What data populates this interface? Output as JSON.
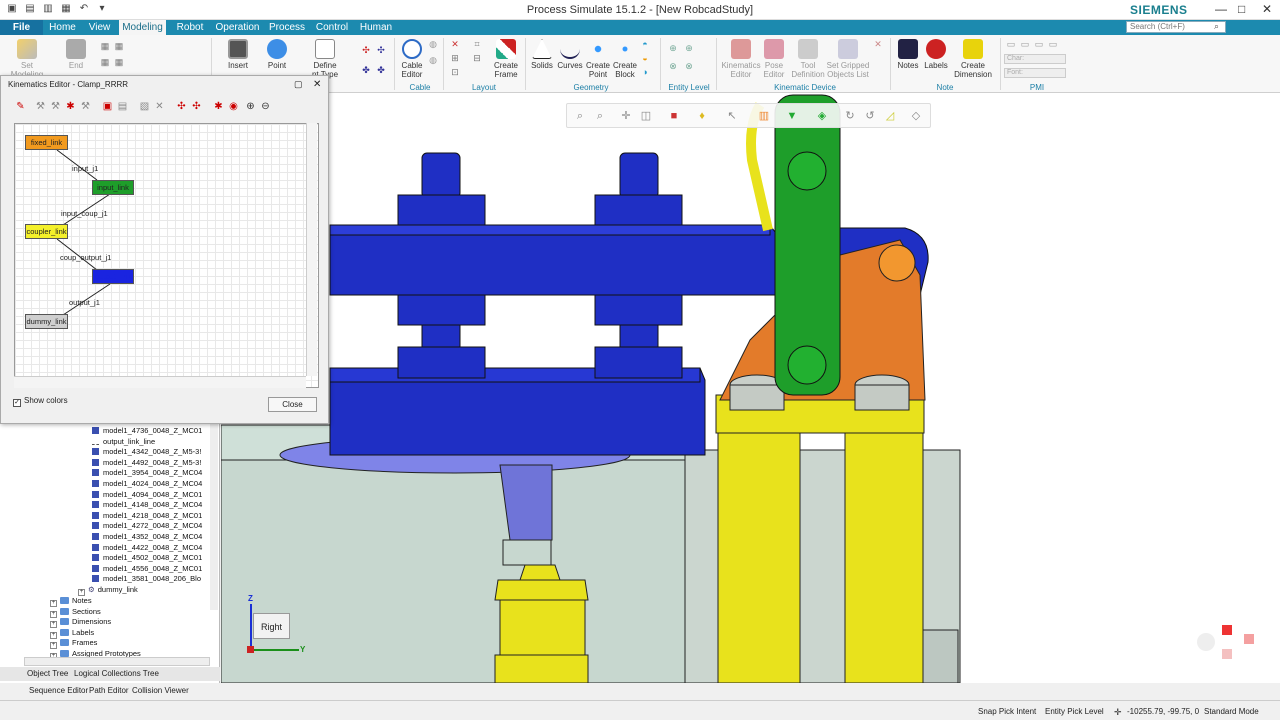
{
  "app": {
    "title": "Process Simulate 15.1.2 - [New RobcadStudy]",
    "brand": "SIEMENS"
  },
  "menu": {
    "tabs": [
      "File",
      "Home",
      "View",
      "Modeling",
      "Robot",
      "Operation",
      "Process",
      "Control",
      "Human"
    ],
    "active": "Modeling"
  },
  "search": {
    "placeholder": "Search (Ctrl+F)"
  },
  "ribbon": {
    "buttons": {
      "set_modeling": "Set Modeling",
      "end": "End",
      "insert": "Insert",
      "point": "Point",
      "define": "Define",
      "joint_type": "nt Type",
      "cable_editor_1": "Cable",
      "cable_editor_2": "Editor",
      "create_frame_1": "Create",
      "create_frame_2": "Frame",
      "solids": "Solids",
      "curves": "Curves",
      "create_point_1": "Create",
      "create_point_2": "Point",
      "create_block_1": "Create",
      "create_block_2": "Block",
      "kinematics_editor_1": "Kinematics",
      "kinematics_editor_2": "Editor",
      "pose_editor_1": "Pose",
      "pose_editor_2": "Editor",
      "tool_definition_1": "Tool",
      "tool_definition_2": "Definition",
      "set_gripped_1": "Set Gripped",
      "set_gripped_2": "Objects List",
      "notes": "Notes",
      "labels": "Labels",
      "create_dimension_1": "Create",
      "create_dimension_2": "Dimension"
    },
    "groups": {
      "cable": "Cable",
      "layout": "Layout",
      "geometry": "Geometry",
      "entity_level": "Entity Level",
      "kinematic_device": "Kinematic Device",
      "note": "Note",
      "pmi": "PMI"
    },
    "pmi": {
      "char": "Char:",
      "font": "Font:"
    }
  },
  "kinematics_editor": {
    "title": "Kinematics Editor - Clamp_RRRR",
    "links": [
      "fixed_link",
      "input_link",
      "coupler_link",
      "output_link",
      "dummy_link"
    ],
    "joints": [
      "input_j1",
      "input_coup_j1",
      "coup_output_j1",
      "output_j1"
    ],
    "show_colors": "Show colors",
    "close": "Close"
  },
  "tree": {
    "items": [
      "model1_4736_0048_Z_MC01",
      "output_link_line",
      "model1_4342_0048_Z_M5-3!",
      "model1_4492_0048_Z_M5-3!",
      "model1_3954_0048_Z_MC04",
      "model1_4024_0048_Z_MC04",
      "model1_4094_0048_Z_MC01",
      "model1_4148_0048_Z_MC04",
      "model1_4218_0048_Z_MC01",
      "model1_4272_0048_Z_MC04",
      "model1_4352_0048_Z_MC04",
      "model1_4422_0048_Z_MC04",
      "model1_4502_0048_Z_MC01",
      "model1_4556_0048_Z_MC01",
      "model1_3581_0048_206_Blo"
    ],
    "dummy_link": "dummy_link",
    "folders": [
      "Notes",
      "Sections",
      "Dimensions",
      "Labels",
      "Frames",
      "Assigned Prototypes"
    ]
  },
  "tree_tabs": [
    "Object Tree",
    "Logical Collections Tree"
  ],
  "bottom_tabs": [
    "Sequence Editor",
    "Path Editor",
    "Collision Viewer"
  ],
  "viewport": {
    "view_label": "Right",
    "axis_z": "Z",
    "axis_y": "Y"
  },
  "status": {
    "snap": "Snap Pick Intent",
    "entity": "Entity Pick Level",
    "coords": "-10255.79, -99.75, 0",
    "mode": "Standard Mode"
  },
  "colors": {
    "menubar": "#1c8aaf",
    "part_blue": "#1f2fc4",
    "clamp_green": "#1e9e2a",
    "clamp_orange": "#e37b2a",
    "cylinder_yellow": "#e6e21c"
  }
}
